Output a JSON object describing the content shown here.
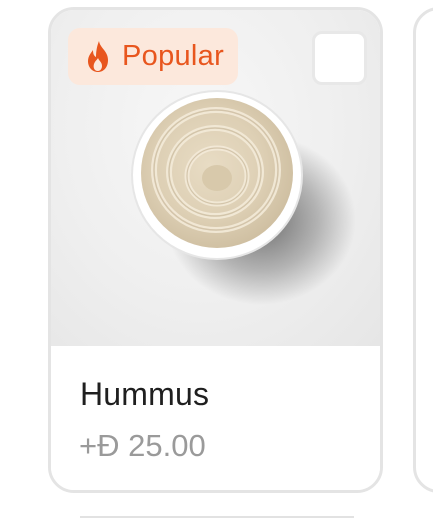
{
  "product": {
    "badge": {
      "label": "Popular",
      "icon": "fire-icon",
      "color": "#e8561e",
      "background": "#fce8dc"
    },
    "image": "hummus-bowl-image",
    "selected": false,
    "name": "Hummus",
    "price": "+Đ 25.00"
  }
}
